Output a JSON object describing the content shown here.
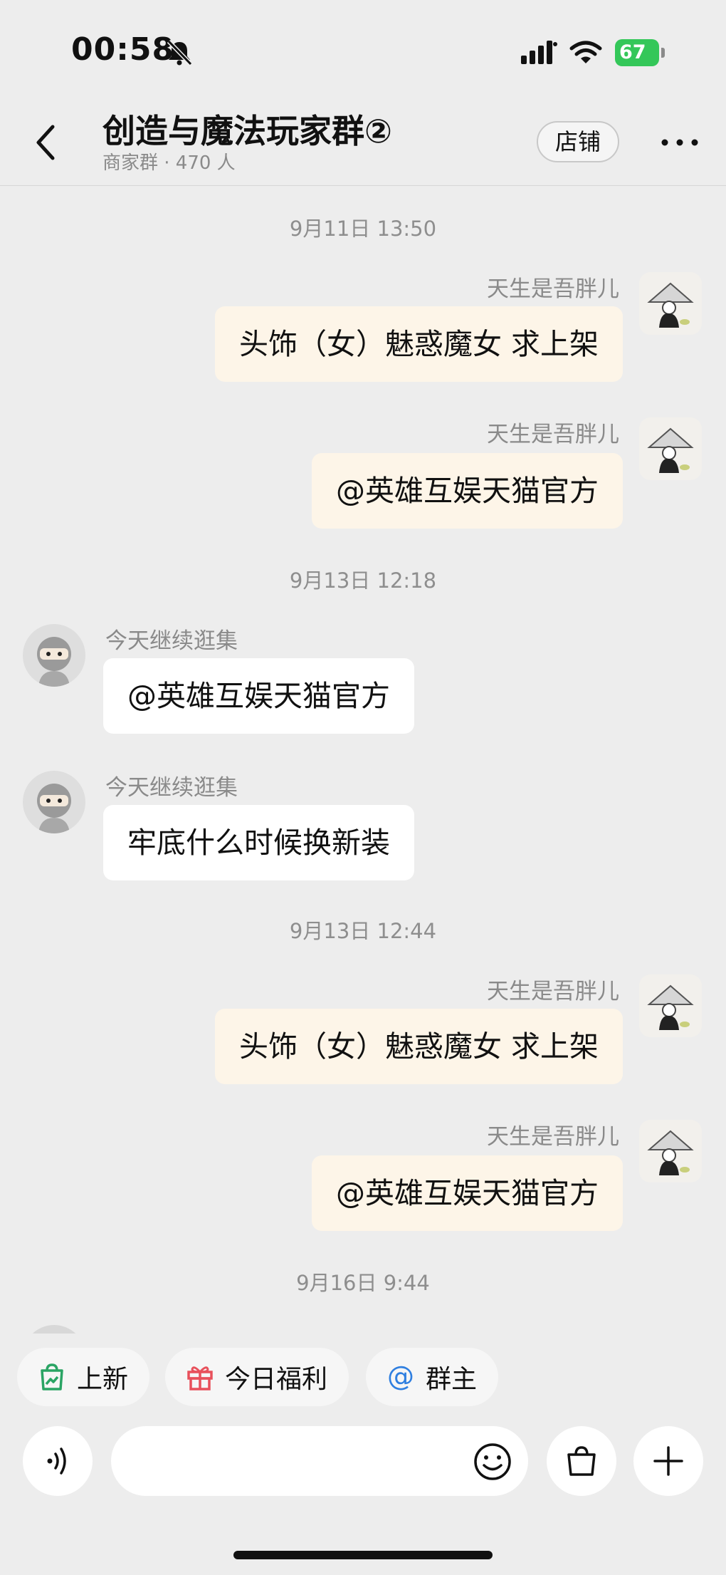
{
  "status_bar": {
    "time": "00:58",
    "battery": "67"
  },
  "header": {
    "title": "创造与魔法玩家群②",
    "subtitle": "商家群 · 470 人",
    "shop_button": "店铺"
  },
  "messages": [
    {
      "type": "time",
      "text": "9月11日 13:50"
    },
    {
      "type": "self",
      "sender": "天生是吾胖儿",
      "text": "头饰（女）魅惑魔女  求上架"
    },
    {
      "type": "self",
      "sender": "天生是吾胖儿",
      "text": "@英雄互娱天猫官方"
    },
    {
      "type": "time",
      "text": "9月13日 12:18"
    },
    {
      "type": "other",
      "sender": "今天继续逛集",
      "text": "@英雄互娱天猫官方"
    },
    {
      "type": "other",
      "sender": "今天继续逛集",
      "text": "牢底什么时候换新装"
    },
    {
      "type": "time",
      "text": "9月13日 12:44"
    },
    {
      "type": "self",
      "sender": "天生是吾胖儿",
      "text": "头饰（女）魅惑魔女  求上架"
    },
    {
      "type": "self",
      "sender": "天生是吾胖儿",
      "text": "@英雄互娱天猫官方"
    },
    {
      "type": "time",
      "text": "9月16日 9:44"
    }
  ],
  "quick_actions": [
    {
      "label": "上新",
      "icon": "shopping-bag-chart-icon",
      "color": "#2aa464"
    },
    {
      "label": "今日福利",
      "icon": "gift-icon",
      "color": "#e8505b"
    },
    {
      "label": "群主",
      "icon": "at-sign-icon",
      "color": "#2f7fe0"
    }
  ],
  "input_bar": {
    "voice_icon": "voice-icon",
    "emoji_icon": "emoji-icon",
    "bag_icon": "shopping-bag-icon",
    "plus_icon": "plus-icon"
  }
}
